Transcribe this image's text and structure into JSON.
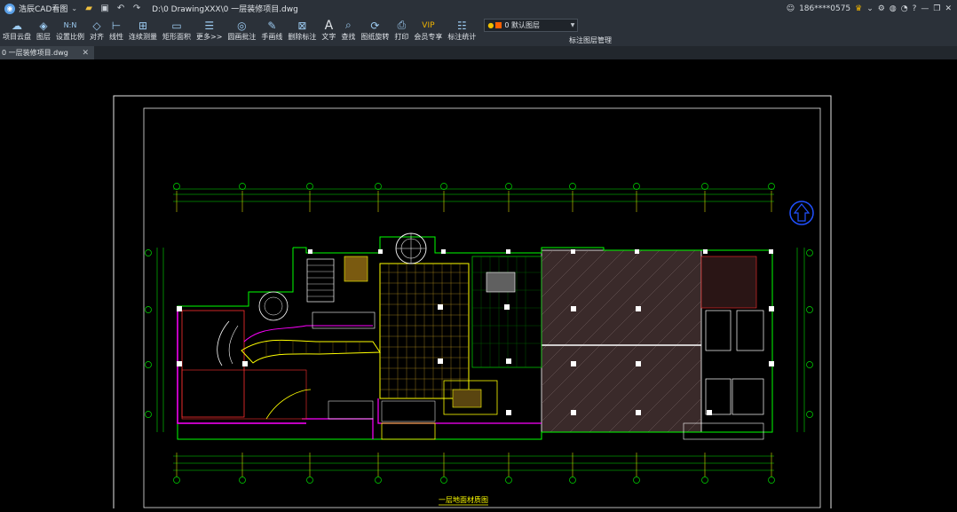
{
  "titlebar": {
    "app_name": "浩辰CAD看图",
    "file_path": "D:\\0 DrawingXXX\\0 一层装修项目.dwg",
    "user": "186****0575"
  },
  "toolbar": {
    "items": [
      {
        "label": "项目云盘",
        "icon": "cloud-icon"
      },
      {
        "label": "图层",
        "icon": "layers-icon"
      },
      {
        "label": "设置比例",
        "icon": "scale-icon"
      },
      {
        "label": "对齐",
        "icon": "align-icon"
      },
      {
        "label": "线性",
        "icon": "linear-dim-icon"
      },
      {
        "label": "连续测量",
        "icon": "continuous-measure-icon"
      },
      {
        "label": "矩形面积",
        "icon": "rect-area-icon"
      },
      {
        "label": "更多>>",
        "icon": "more-icon"
      },
      {
        "label": "圆画批注",
        "icon": "annotate-icon"
      },
      {
        "label": "手画线",
        "icon": "pen-icon"
      },
      {
        "label": "删除标注",
        "icon": "delete-annotation-icon"
      },
      {
        "label": "文字",
        "icon": "text-icon"
      },
      {
        "label": "查找",
        "icon": "find-icon"
      },
      {
        "label": "图纸旋转",
        "icon": "rotate-icon"
      },
      {
        "label": "打印",
        "icon": "print-icon"
      },
      {
        "label": "会员专享",
        "icon": "vip-icon"
      },
      {
        "label": "标注统计",
        "icon": "stats-icon"
      }
    ],
    "layer_selected": "0 默认图层",
    "layer_manager_label": "标注图层管理"
  },
  "tab": {
    "label": "0 一层装修项目.dwg"
  },
  "drawing": {
    "title": "一层地面材质图"
  },
  "colors": {
    "chrome": "#2b3139",
    "canvas": "#000000",
    "cad_yellow": "#ffff00",
    "cad_green": "#00ff00",
    "cad_magenta": "#ff00ff",
    "cad_red": "#ff0000",
    "cad_blue": "#2050ff"
  }
}
